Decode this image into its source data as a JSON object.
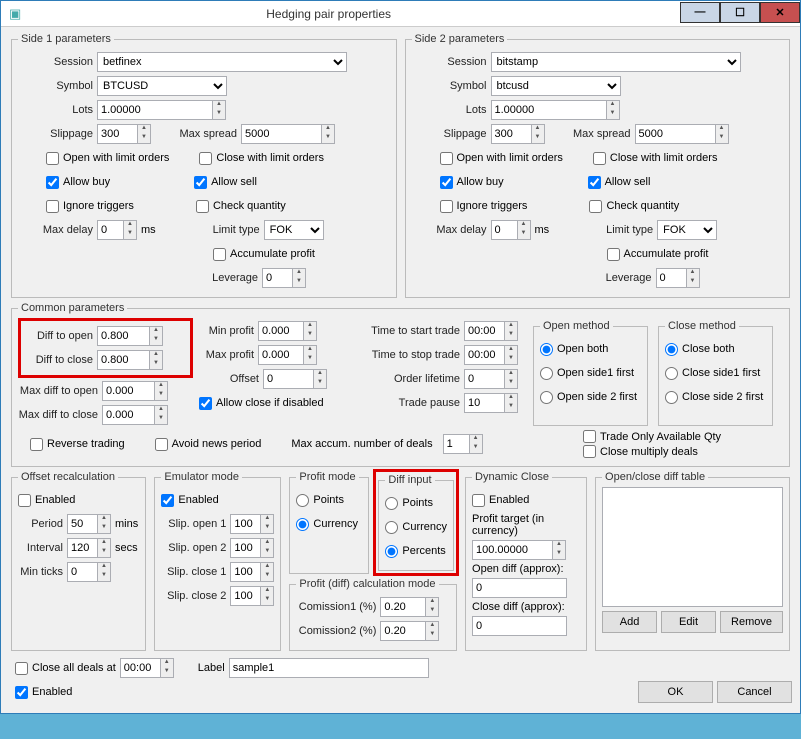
{
  "window": {
    "title": "Hedging pair properties"
  },
  "side1": {
    "legend": "Side 1 parameters",
    "sessionLabel": "Session",
    "session": "betfinex",
    "symbolLabel": "Symbol",
    "symbol": "BTCUSD",
    "lotsLabel": "Lots",
    "lots": "1.00000",
    "slippageLabel": "Slippage",
    "slippage": "300",
    "maxSpreadLabel": "Max spread",
    "maxSpread": "5000",
    "openLimit": "Open with limit orders",
    "closeLimit": "Close with limit orders",
    "allowBuy": "Allow buy",
    "allowSell": "Allow sell",
    "ignoreTriggers": "Ignore triggers",
    "checkQty": "Check quantity",
    "maxDelayLabel": "Max delay",
    "maxDelay": "0",
    "ms": "ms",
    "limitTypeLabel": "Limit type",
    "limitType": "FOK",
    "accumProfit": "Accumulate profit",
    "leverageLabel": "Leverage",
    "leverage": "0"
  },
  "side2": {
    "legend": "Side 2 parameters",
    "session": "bitstamp",
    "symbol": "btcusd",
    "lots": "1.00000",
    "slippage": "300",
    "maxSpread": "5000",
    "maxDelay": "0",
    "limitType": "FOK",
    "leverage": "0"
  },
  "common": {
    "legend": "Common parameters",
    "diffOpenLabel": "Diff to open",
    "diffOpen": "0.800",
    "diffCloseLabel": "Diff to close",
    "diffClose": "0.800",
    "minProfitLabel": "Min profit",
    "minProfit": "0.000",
    "maxProfitLabel": "Max profit",
    "maxProfit": "0.000",
    "maxDiffOpenLabel": "Max diff to open",
    "maxDiffOpen": "0.000",
    "maxDiffCloseLabel": "Max diff to close",
    "maxDiffClose": "0.000",
    "offsetLabel": "Offset",
    "offset": "0",
    "allowCloseDisabled": "Allow close if disabled",
    "reverse": "Reverse trading",
    "avoidNews": "Avoid news period",
    "maxAccumLabel": "Max accum. number of deals",
    "maxAccum": "1",
    "timeStartLabel": "Time to start trade",
    "timeStart": "00:00",
    "timeStopLabel": "Time to stop trade",
    "timeStop": "00:00",
    "orderLifeLabel": "Order lifetime",
    "orderLife": "0",
    "tradePauseLabel": "Trade pause",
    "tradePause": "10",
    "openMethodLabel": "Open method",
    "om_both": "Open both",
    "om_s1": "Open side1 first",
    "om_s2": "Open side 2 first",
    "closeMethodLabel": "Close method",
    "cm_both": "Close both",
    "cm_s1": "Close side1 first",
    "cm_s2": "Close side 2 first",
    "tradeOnlyAvail": "Trade Only Available Qty",
    "closeMultiply": "Close multiply deals"
  },
  "offset": {
    "legend": "Offset recalculation",
    "enabled": "Enabled",
    "periodLabel": "Period",
    "period": "50",
    "mins": "mins",
    "intervalLabel": "Interval",
    "interval": "120",
    "secs": "secs",
    "minTicksLabel": "Min ticks",
    "minTicks": "0"
  },
  "emu": {
    "legend": "Emulator mode",
    "enabled": "Enabled",
    "so1Label": "Slip. open 1",
    "so1": "100",
    "so2Label": "Slip. open 2",
    "so2": "100",
    "sc1Label": "Slip. close 1",
    "sc1": "100",
    "sc2Label": "Slip. close 2",
    "sc2": "100"
  },
  "profitMode": {
    "legend": "Profit mode",
    "points": "Points",
    "currency": "Currency"
  },
  "diffInput": {
    "legend": "Diff input",
    "points": "Points",
    "currency": "Currency",
    "percents": "Percents"
  },
  "calc": {
    "legend": "Profit (diff) calculation mode",
    "c1Label": "Comission1 (%)",
    "c1": "0.20",
    "c2Label": "Comission2 (%)",
    "c2": "0.20"
  },
  "dyn": {
    "legend": "Dynamic Close",
    "enabled": "Enabled",
    "targetLabel": "Profit target (in currency)",
    "target": "100.00000",
    "openDiffLabel": "Open diff (approx):",
    "openDiff": "0",
    "closeDiffLabel": "Close diff (approx):",
    "closeDiff": "0"
  },
  "table": {
    "legend": "Open/close diff table",
    "add": "Add",
    "edit": "Edit",
    "remove": "Remove"
  },
  "footer": {
    "closeAll": "Close all deals at",
    "closeTime": "00:00",
    "labelTxt": "Label",
    "labelVal": "sample1",
    "enabled": "Enabled",
    "ok": "OK",
    "cancel": "Cancel"
  }
}
